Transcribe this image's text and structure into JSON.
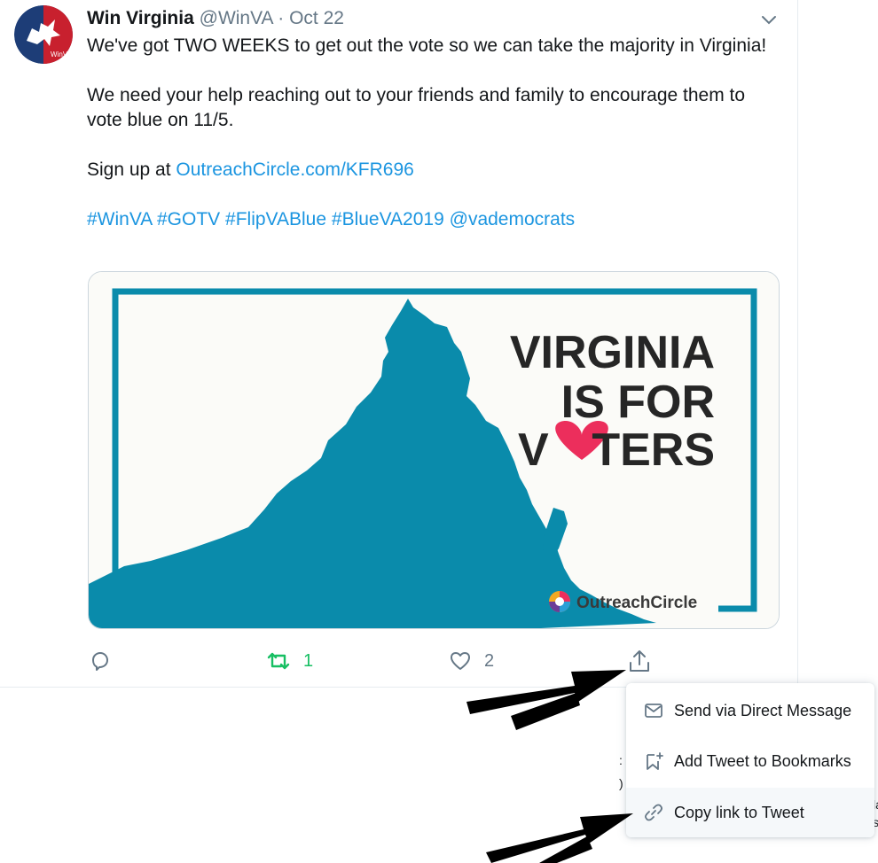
{
  "tweet": {
    "author_name": "Win Virginia",
    "handle": "@WinVA",
    "separator": "·",
    "date": "Oct 22",
    "lines": [
      "We've got TWO WEEKS to get out the vote so we can take the majority in Virginia!",
      "We need your help reaching out to your friends and family to encourage them to vote blue on 11/5."
    ],
    "signup_prefix": "Sign up at ",
    "signup_link": "OutreachCircle.com/KFR696",
    "hashtags": [
      "#WinVA",
      "#GOTV",
      "#FlipVABlue",
      "#BlueVA2019",
      "@vademocrats"
    ],
    "avatar_text": "WinVA"
  },
  "card": {
    "headline_1": "VIRGINIA",
    "headline_2": "IS FOR",
    "headline_3a": "V",
    "headline_3b": "TERS",
    "brand": "OutreachCircle",
    "colors": {
      "map": "#0a8bab",
      "heart": "#ec2e5c",
      "text": "#262626"
    }
  },
  "actions": {
    "reply_icon": "reply-icon",
    "retweet_icon": "retweet-icon",
    "retweet_count": "1",
    "like_icon": "heart-icon",
    "like_count": "2",
    "share_icon": "share-icon"
  },
  "share_menu": {
    "items": [
      {
        "icon": "envelope-icon",
        "label": "Send via Direct Message"
      },
      {
        "icon": "bookmark-add-icon",
        "label": "Add Tweet to Bookmarks"
      },
      {
        "icon": "link-icon",
        "label": "Copy link to Tweet"
      }
    ]
  },
  "colors": {
    "link_blue": "#1b95e0",
    "retweet_green": "#17bf63",
    "muted_gray": "#657786"
  }
}
